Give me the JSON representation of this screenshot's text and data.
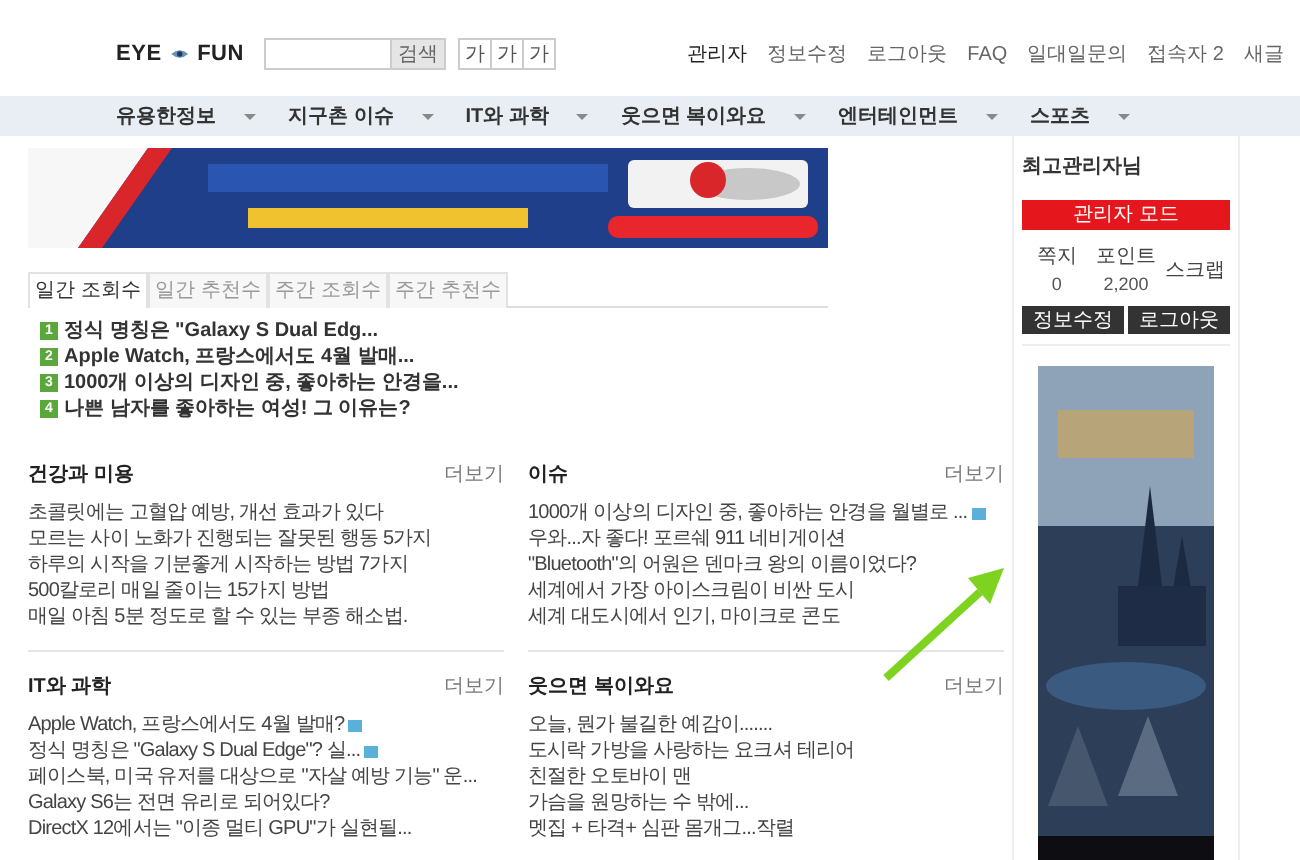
{
  "header": {
    "logo_left": "EYE",
    "logo_right": "FUN",
    "search_button": "검색",
    "font_buttons": [
      "가",
      "가",
      "가"
    ],
    "links": [
      "관리자",
      "정보수정",
      "로그아웃",
      "FAQ",
      "일대일문의",
      "접속자 2",
      "새글"
    ]
  },
  "nav": [
    {
      "label": "유용한정보"
    },
    {
      "label": "지구촌 이슈"
    },
    {
      "label": "IT와 과학"
    },
    {
      "label": "웃으면 복이와요"
    },
    {
      "label": "엔터테인먼트"
    },
    {
      "label": "스포츠"
    }
  ],
  "ad_banner": {
    "kind": "picture"
  },
  "tabs": [
    {
      "label": "일간 조회수",
      "selected": true
    },
    {
      "label": "일간 추천수",
      "selected": false
    },
    {
      "label": "주간 조회수",
      "selected": false
    },
    {
      "label": "주간 추천수",
      "selected": false
    }
  ],
  "top_list": [
    {
      "rank": "1",
      "title": "정식 명칭은 \"Galaxy S Dual Edg..."
    },
    {
      "rank": "2",
      "title": "Apple Watch, 프랑스에서도 4월 발매..."
    },
    {
      "rank": "3",
      "title": "1000개 이상의 디자인 중, 좋아하는 안경을..."
    },
    {
      "rank": "4",
      "title": "나쁜 남자를 좋아하는 여성! 그 이유는?"
    }
  ],
  "sections": [
    {
      "title": "건강과 미용",
      "more": "더보기",
      "items": [
        {
          "title": "초콜릿에는 고혈압 예방, 개선 효과가 있다",
          "comment": false
        },
        {
          "title": "모르는 사이 노화가 진행되는 잘못된 행동 5가지",
          "comment": false
        },
        {
          "title": "하루의 시작을 기분좋게 시작하는 방법 7가지",
          "comment": false
        },
        {
          "title": "500칼로리 매일 줄이는 15가지 방법",
          "comment": false
        },
        {
          "title": "매일 아침 5분 정도로 할 수 있는 부종 해소법.",
          "comment": false
        }
      ]
    },
    {
      "title": "이슈",
      "more": "더보기",
      "items": [
        {
          "title": "1000개 이상의 디자인 중, 좋아하는 안경을 월별로 ...",
          "comment": true
        },
        {
          "title": "우와...자 좋다! 포르쉐 911 네비게이션",
          "comment": false
        },
        {
          "title": "\"Bluetooth\"의 어원은 덴마크 왕의 이름이었다?",
          "comment": false
        },
        {
          "title": "세계에서 가장 아이스크림이 비싼 도시",
          "comment": false
        },
        {
          "title": "세계 대도시에서 인기, 마이크로 콘도",
          "comment": false
        }
      ]
    },
    {
      "title": "IT와 과학",
      "more": "더보기",
      "items": [
        {
          "title": "Apple Watch, 프랑스에서도 4월 발매?",
          "comment": true
        },
        {
          "title": "정식 명칭은 \"Galaxy S Dual Edge\"? 실...",
          "comment": true
        },
        {
          "title": "페이스북, 미국 유저를 대상으로 \"자살 예방 기능\" 운...",
          "comment": false
        },
        {
          "title": "Galaxy S6는 전면 유리로 되어있다?",
          "comment": false
        },
        {
          "title": "DirectX 12에서는 \"이종 멀티 GPU\"가 실현될...",
          "comment": false
        }
      ]
    },
    {
      "title": "웃으면 복이와요",
      "more": "더보기",
      "items": [
        {
          "title": "오늘, 뭔가 불길한 예감이.......",
          "comment": false
        },
        {
          "title": "도시락 가방을 사랑하는 요크셔 테리어",
          "comment": false
        },
        {
          "title": "친절한 오토바이 맨",
          "comment": false
        },
        {
          "title": "가슴을 원망하는 수 밖에...",
          "comment": false
        },
        {
          "title": "멧집 + 타격+ 심판 몸개그...작렬",
          "comment": false
        }
      ]
    }
  ],
  "sidebar": {
    "greeting": "최고관리자님",
    "admin_button": "관리자 모드",
    "stats": [
      {
        "label": "쪽지",
        "value": "0"
      },
      {
        "label": "포인트",
        "value": "2,200"
      },
      {
        "label": "스크랩"
      }
    ],
    "buttons": [
      "정보수정",
      "로그아웃"
    ],
    "ad": {
      "kind": "picture"
    }
  },
  "overlay": {
    "kind": "arrow"
  }
}
